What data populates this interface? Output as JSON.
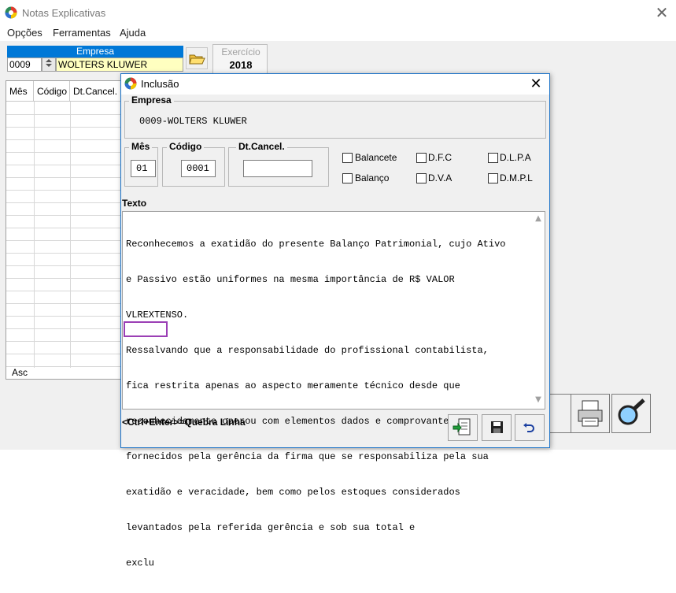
{
  "window": {
    "title": "Notas Explicativas",
    "close_glyph": "✕"
  },
  "menu": {
    "items": [
      "Opções",
      "Ferramentas",
      "Ajuda"
    ]
  },
  "empresa": {
    "header": "Empresa",
    "code": "0009",
    "name": "WOLTERS KLUWER"
  },
  "exercicio": {
    "label": "Exercício",
    "value": "2018"
  },
  "grid": {
    "columns": [
      "Mês",
      "Código",
      "Dt.Cancel."
    ],
    "footer_label": "Asc"
  },
  "dialog": {
    "title": "Inclusão",
    "close_glyph": "✕",
    "empresa_group": {
      "legend": "Empresa",
      "value": "0009-WOLTERS KLUWER"
    },
    "mes": {
      "label": "Mês",
      "value": "01"
    },
    "codigo": {
      "label": "Código",
      "value": "0001"
    },
    "dtcancel": {
      "label": "Dt.Cancel.",
      "value": ""
    },
    "checkboxes": {
      "balancete": "Balancete",
      "balanco": "Balanço",
      "dfc": "D.F.C",
      "dva": "D.V.A",
      "dlpa": "D.L.P.A",
      "dmpl": "D.M.P.L"
    },
    "texto_label": "Texto",
    "texto_lines": [
      "Reconhecemos a exatidão do presente Balanço Patrimonial, cujo Ativo",
      "e Passivo estão uniformes na mesma importância de R$ VALOR",
      "VLREXTENSO.",
      "Ressalvando que a responsabilidade do profissional contabilista,",
      "fica restrita apenas ao aspecto meramente técnico desde que",
      "reconhecidamente operou com elementos dados e comprovantes",
      "fornecidos pela gerência da firma que se responsabiliza pela sua",
      "exatidão e veracidade, bem como pelos estoques considerados",
      "levantados pela referida gerência e sob sua total e",
      "exclu"
    ],
    "hint": "<Ctrl+Enter>=Quebra Linha"
  },
  "colors": {
    "accent": "#0078d7",
    "highlight_border": "#9b3fb5",
    "empresa_name_bg": "#ffffc0"
  }
}
